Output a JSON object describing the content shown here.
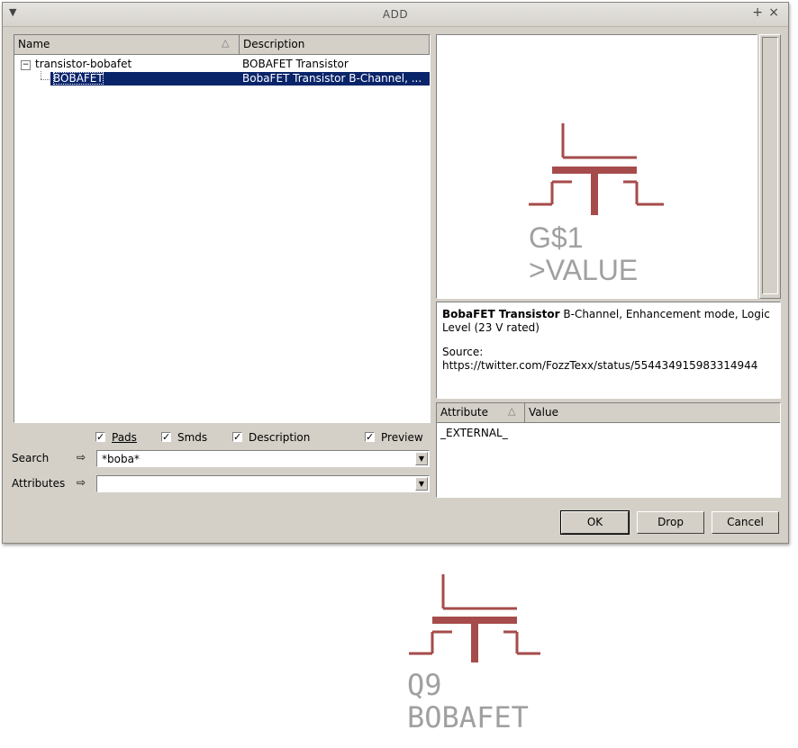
{
  "window": {
    "title": "ADD"
  },
  "tree": {
    "columns": {
      "name": "Name",
      "description": "Description"
    },
    "rows": [
      {
        "name": "transistor-bobafet",
        "description": "BOBAFET Transistor",
        "expander": "⊟"
      },
      {
        "name": "BOBAFET",
        "description": "BobaFET Transistor B-Channel, ..."
      }
    ]
  },
  "preview": {
    "gate_name": "G$1",
    "value_label": ">VALUE"
  },
  "description": {
    "title": "BobaFET Transistor",
    "text": " B-Channel, Enhancement mode, Logic Level (23 V rated)",
    "source_label": "Source:",
    "source_url": "https://twitter.com/FozzTexx/status/554434915983314944"
  },
  "attributes": {
    "columns": {
      "attribute": "Attribute",
      "value": "Value"
    },
    "rows": [
      {
        "attribute": "_EXTERNAL_",
        "value": ""
      }
    ]
  },
  "filters": {
    "pads": {
      "label": "Pads",
      "checked": true
    },
    "smds": {
      "label": "Smds",
      "checked": true
    },
    "description": {
      "label": "Description",
      "checked": true
    },
    "preview": {
      "label": "Preview",
      "checked": true
    }
  },
  "search": {
    "label": "Search",
    "value": "*boba*"
  },
  "attributes_filter": {
    "label": "Attributes",
    "value": ""
  },
  "buttons": {
    "ok": "OK",
    "drop": "Drop",
    "cancel": "Cancel"
  },
  "canvas": {
    "part_name": "Q9",
    "part_value": "BOBAFET"
  },
  "colors": {
    "symbol": "#a64b4b",
    "text_gray": "#a0a0a0",
    "selection": "#0a246a"
  }
}
